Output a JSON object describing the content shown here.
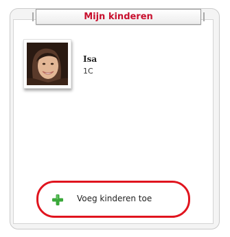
{
  "header": {
    "title": "Mijn kinderen"
  },
  "children": [
    {
      "name": "Isa",
      "class": "1C"
    }
  ],
  "actions": {
    "add_children_label": "Voeg kinderen toe"
  },
  "colors": {
    "header_text": "#c8102e",
    "highlight_outline": "#e0141e",
    "plus_icon": "#3aa83a"
  }
}
